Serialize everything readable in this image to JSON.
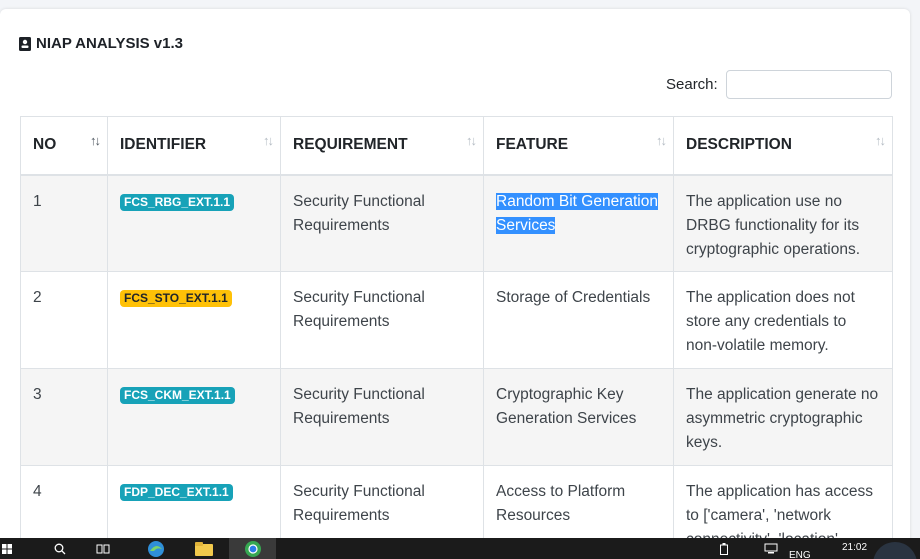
{
  "header": {
    "title": "NIAP ANALYSIS v1.3"
  },
  "search": {
    "label": "Search:",
    "value": "",
    "placeholder": ""
  },
  "table": {
    "columns": [
      "NO",
      "IDENTIFIER",
      "REQUIREMENT",
      "FEATURE",
      "DESCRIPTION"
    ],
    "rows": [
      {
        "no": "1",
        "identifier": "FCS_RBG_EXT.1.1",
        "badge_color": "#17a2b8",
        "badge_text_color": "#ffffff",
        "requirement": "Security Functional Requirements",
        "feature": "Random Bit Generation Services",
        "description": "The application use no DRBG functionality for its cryptographic operations."
      },
      {
        "no": "2",
        "identifier": "FCS_STO_EXT.1.1",
        "badge_color": "#ffc107",
        "badge_text_color": "#212529",
        "requirement": "Security Functional Requirements",
        "feature": "Storage of Credentials",
        "description": "The application does not store any credentials to non-volatile memory."
      },
      {
        "no": "3",
        "identifier": "FCS_CKM_EXT.1.1",
        "badge_color": "#17a2b8",
        "badge_text_color": "#ffffff",
        "requirement": "Security Functional Requirements",
        "feature": "Cryptographic Key Generation Services",
        "description": "The application generate no asymmetric cryptographic keys."
      },
      {
        "no": "4",
        "identifier": "FDP_DEC_EXT.1.1",
        "badge_color": "#17a2b8",
        "badge_text_color": "#ffffff",
        "requirement": "Security Functional Requirements",
        "feature": "Access to Platform Resources",
        "description": "The application has access to ['camera', 'network connectivity', 'location',"
      }
    ]
  },
  "taskbar": {
    "lang": "ENG",
    "time": "21:02"
  },
  "colors": {
    "accent_info": "#17a2b8",
    "accent_warning": "#ffc107",
    "selection": "#3390ff"
  }
}
